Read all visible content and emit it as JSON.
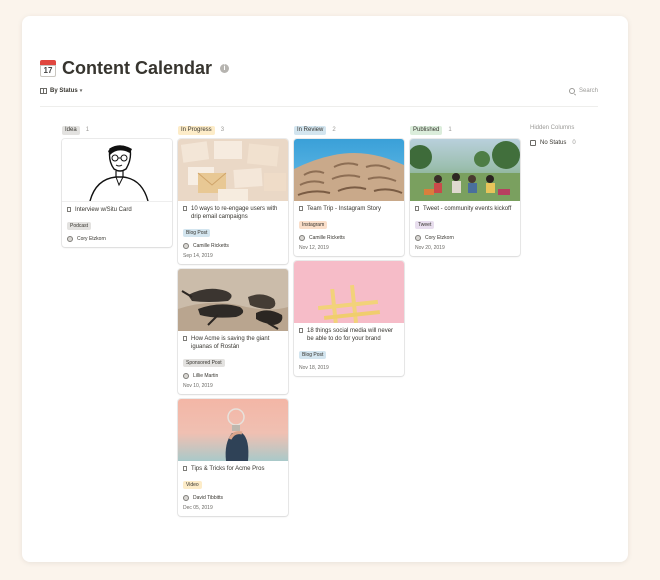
{
  "page": {
    "title": "Content Calendar",
    "calendar_day": "17"
  },
  "toolbar": {
    "view_label": "By Status",
    "search_label": "Search"
  },
  "colors": {
    "idea_tag": "#e3e2e0",
    "in_progress_tag": "#fdecc8",
    "in_review_tag": "#d3e5ef",
    "published_tag": "#dbeddb",
    "podcast_tag": "#e3e2e0",
    "blog_post_tag": "#d3e5ef",
    "instagram_tag": "#fadec9",
    "sponsored_post_tag": "#e3e2e0",
    "video_tag": "#fdecc8",
    "tweet_tag": "#e8deee"
  },
  "columns": [
    {
      "label": "Idea",
      "count": "1",
      "cards": [
        {
          "title": "Interview w/Situ Card",
          "tag": "Podcast",
          "person": "Cory Etzkorn",
          "date": ""
        }
      ]
    },
    {
      "label": "In Progress",
      "count": "3",
      "cards": [
        {
          "title": "10 ways to re-engage users with drip email campaigns",
          "tag": "Blog Post",
          "person": "Camille Ricketts",
          "date": "Sep 14, 2019"
        },
        {
          "title": "How Acme is saving the giant iguanas of Rostán",
          "tag": "Sponsored Post",
          "person": "Lillie Martin",
          "date": "Nov 10, 2019"
        },
        {
          "title": "Tips & Tricks for Acme Pros",
          "tag": "Video",
          "person": "David Tibbitts",
          "date": "Dec 05, 2019"
        }
      ]
    },
    {
      "label": "In Review",
      "count": "2",
      "cards": [
        {
          "title": "Team Trip - Instagram Story",
          "tag": "Instagram",
          "person": "Camille Ricketts",
          "date": "Nov 12, 2019"
        },
        {
          "title": "18 things social media will never be able to do for your brand",
          "tag": "Blog Post",
          "person": "",
          "date": "Nov 18, 2019"
        }
      ]
    },
    {
      "label": "Published",
      "count": "1",
      "cards": [
        {
          "title": "Tweet - community events kickoff",
          "tag": "Tweet",
          "person": "Cory Etzkorn",
          "date": "Nov 20, 2019"
        }
      ]
    }
  ],
  "hidden": {
    "label": "Hidden Columns",
    "item_label": "No Status",
    "item_count": "0"
  }
}
